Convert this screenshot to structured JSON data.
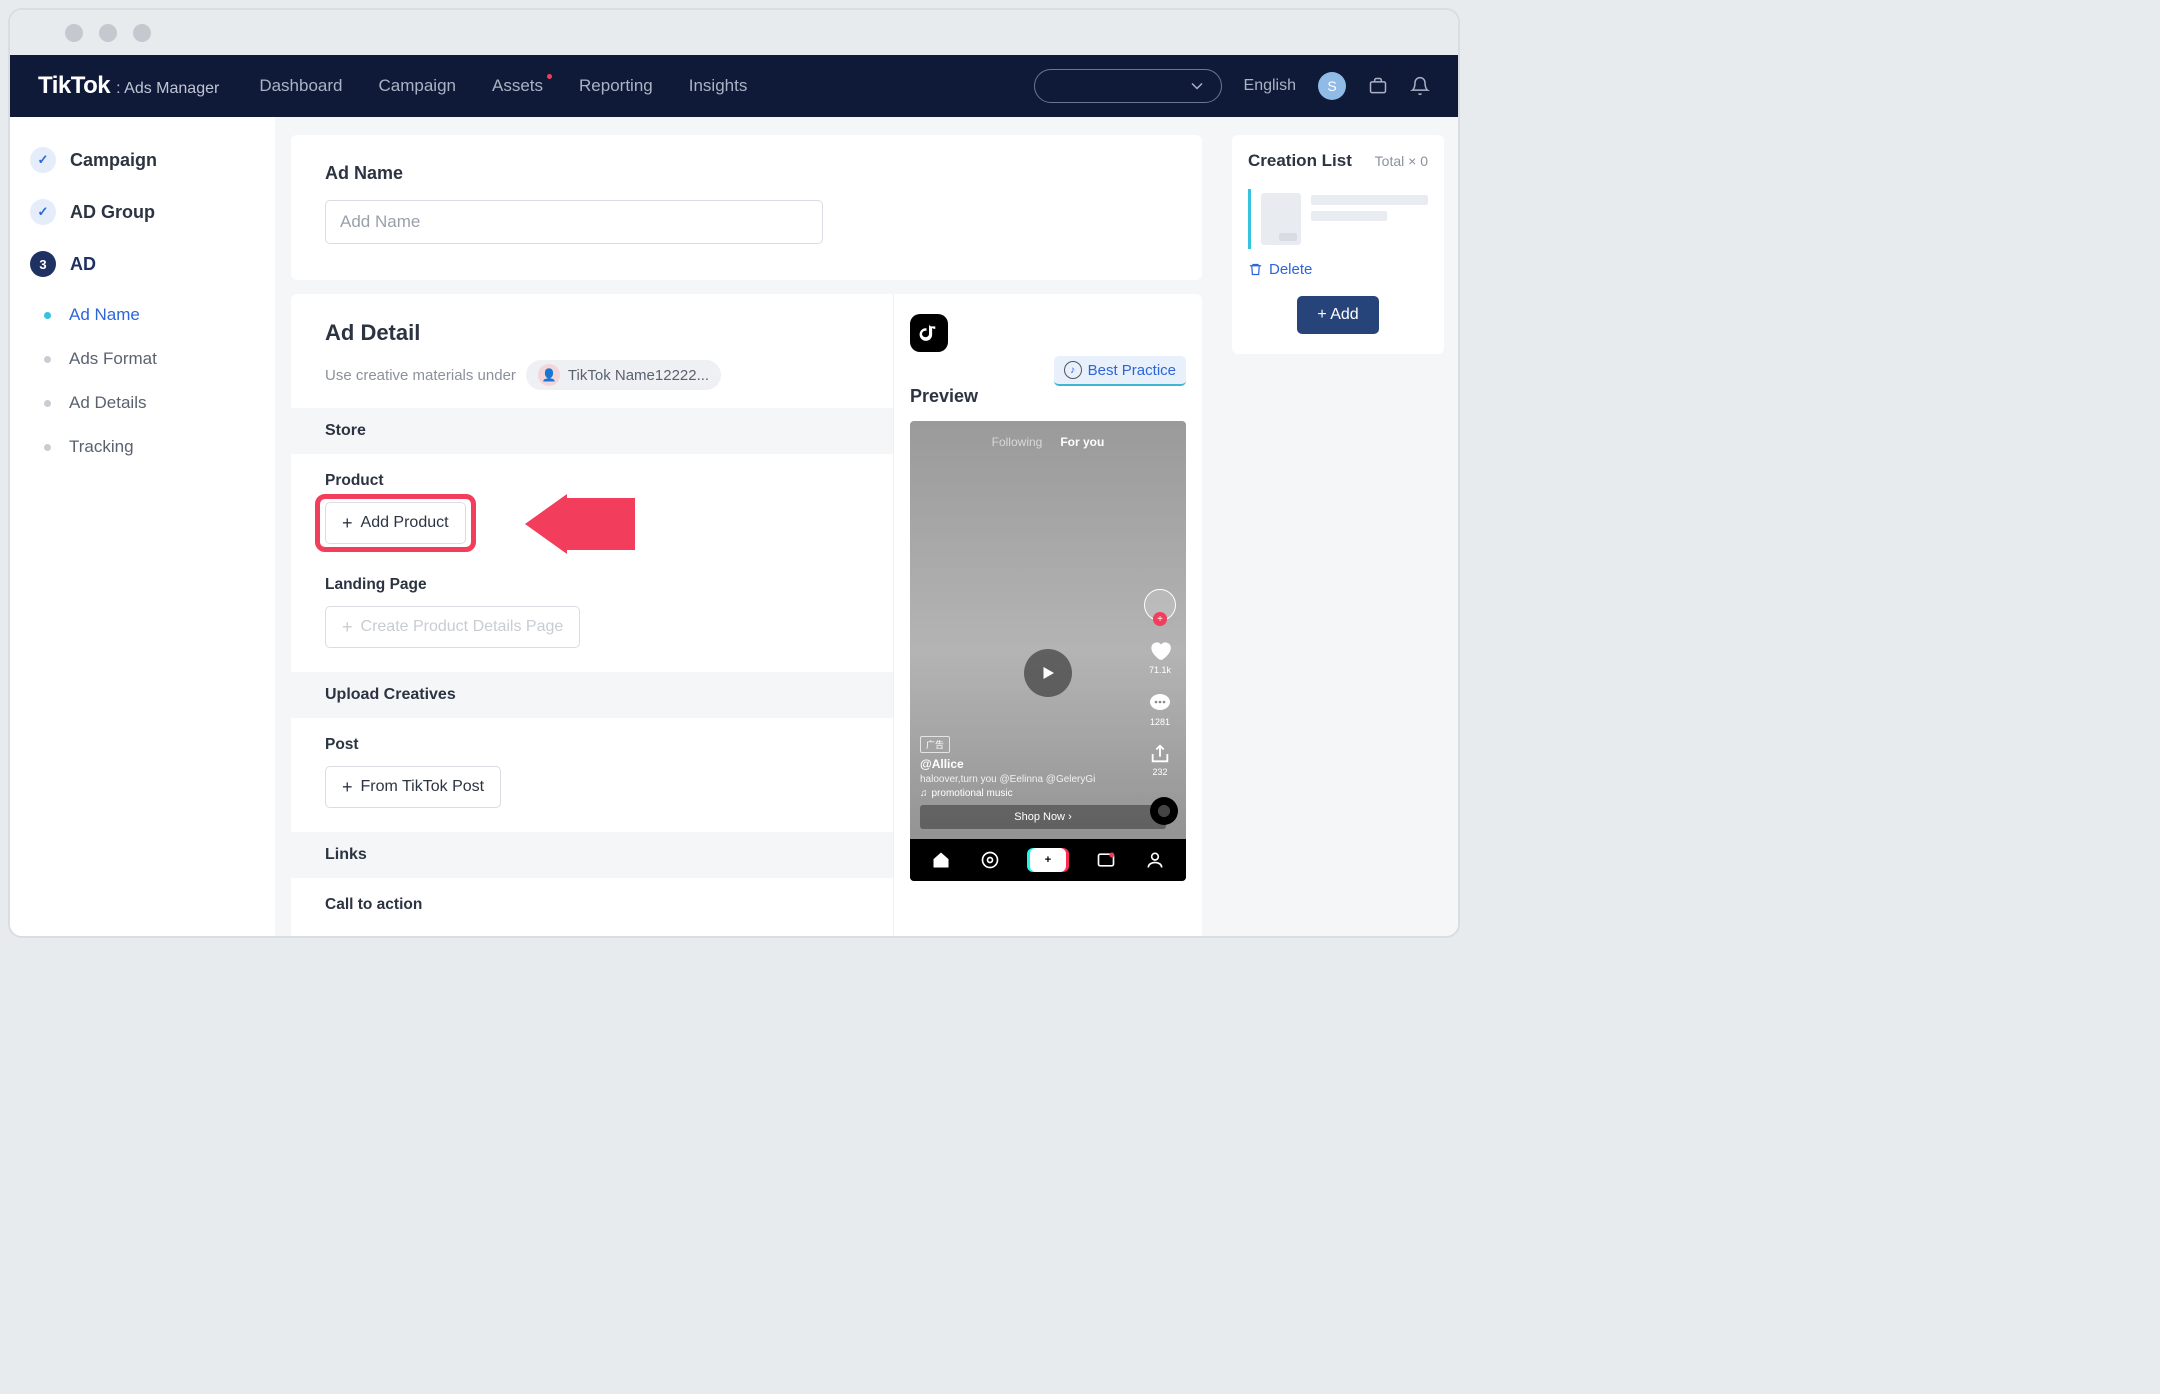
{
  "brand": {
    "name": "TikTok",
    "sub": ": Ads Manager"
  },
  "topnav": [
    "Dashboard",
    "Campaign",
    "Assets",
    "Reporting",
    "Insights"
  ],
  "lang": "English",
  "avatar_letter": "S",
  "sidebar": {
    "steps": [
      {
        "label": "Campaign",
        "done": true
      },
      {
        "label": "AD Group",
        "done": true
      },
      {
        "label": "AD",
        "num": "3",
        "active": true
      }
    ],
    "subs": [
      "Ad Name",
      "Ads Format",
      "Ad Details",
      "Tracking"
    ]
  },
  "adname": {
    "label": "Ad Name",
    "placeholder": "Add Name"
  },
  "detail": {
    "title": "Ad Detail",
    "creative_text": "Use creative materials under",
    "account_name": "TikTok Name12222...",
    "store": "Store",
    "product": "Product",
    "add_product": "Add Product",
    "landing": "Landing Page",
    "create_page": "Create Product Details Page",
    "upload": "Upload Creatives",
    "post": "Post",
    "from_post": "From TikTok Post",
    "links": "Links",
    "cta": "Call to action"
  },
  "best_practice": "Best Practice",
  "preview": {
    "title": "Preview",
    "tabs": {
      "following": "Following",
      "foryou": "For you"
    },
    "like_count": "71.1k",
    "comment_count": "1281",
    "share_count": "232",
    "ad_tag": "广告",
    "username": "@Allice",
    "caption": "haloover,turn you @Eelinna @GeleryGi",
    "music": "promotional music",
    "shop_now": "Shop Now"
  },
  "creation": {
    "title": "Creation List",
    "total_label": "Total",
    "total_count": "× 0",
    "delete": "Delete",
    "add": "Add"
  }
}
